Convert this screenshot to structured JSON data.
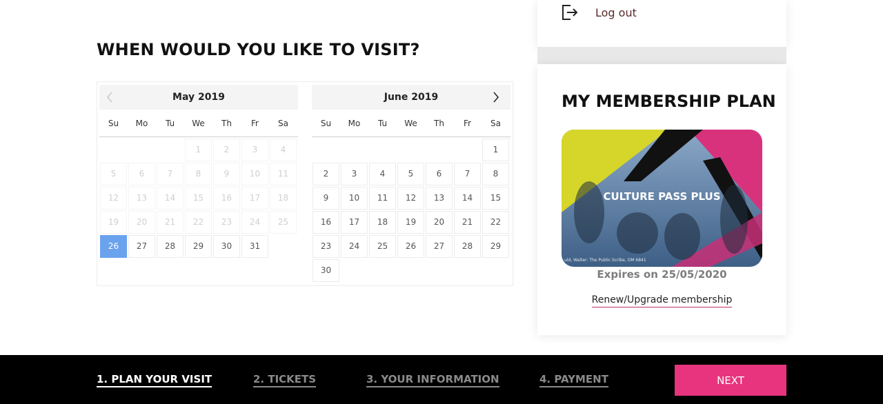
{
  "heading": "WHEN WOULD YOU LIKE TO VISIT?",
  "calendar": {
    "weekdays": [
      "Su",
      "Mo",
      "Tu",
      "We",
      "Th",
      "Fr",
      "Sa"
    ],
    "may": {
      "title": "May 2019",
      "leading_blanks": 3,
      "days": 31,
      "past_through": 25,
      "selected": 26
    },
    "june": {
      "title": "June 2019",
      "leading_blanks": 6,
      "days": 30,
      "past_through": 0,
      "selected": null
    }
  },
  "account": {
    "logout_label": "Log out"
  },
  "membership": {
    "title": "MY MEMBERSHIP PLAN",
    "plan_name": "CULTURE PASS PLUS",
    "image_credit": "uld, Walter: The Public Scribe, OM 6841",
    "expires": "Expires on 25/05/2020",
    "renew_label": "Renew/Upgrade membership"
  },
  "footer": {
    "steps": [
      {
        "label": "1. PLAN YOUR VISIT",
        "active": true
      },
      {
        "label": "2. TICKETS",
        "active": false
      },
      {
        "label": "3. YOUR INFORMATION",
        "active": false
      },
      {
        "label": "4. PAYMENT",
        "active": false
      }
    ],
    "next_label": "NEXT"
  },
  "colors": {
    "accent": "#e8347e",
    "selected_day": "#6aa2ee",
    "footer_bg": "#000000"
  }
}
